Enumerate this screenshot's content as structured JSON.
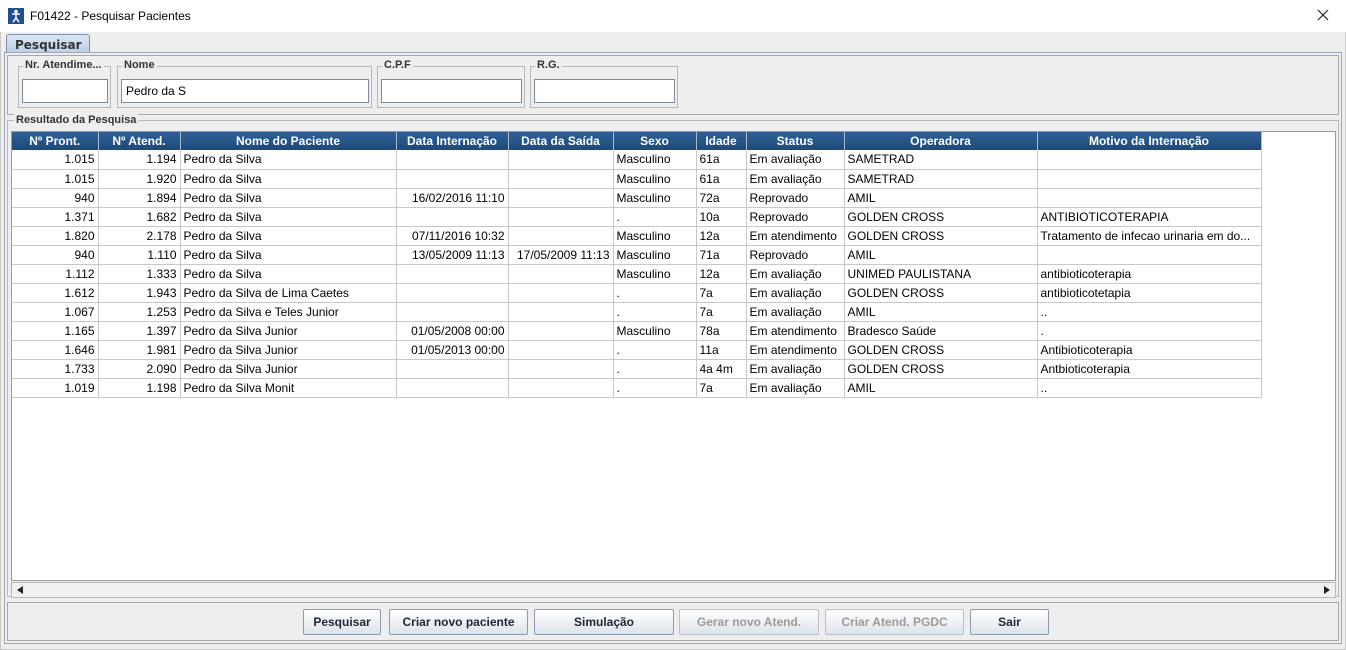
{
  "window": {
    "title": "F01422 - Pesquisar Pacientes",
    "icon": "accessibility-icon",
    "close_icon": "close-icon"
  },
  "tab": {
    "label": "Pesquisar"
  },
  "search": {
    "fields": [
      {
        "label": "Nr. Atendime...",
        "value": ""
      },
      {
        "label": "Nome",
        "value": "Pedro da S"
      },
      {
        "label": "C.P.F",
        "value": ""
      },
      {
        "label": "R.G.",
        "value": ""
      }
    ]
  },
  "results": {
    "group_label": "Resultado da Pesquisa",
    "columns": [
      "Nº Pront.",
      "Nº Atend.",
      "Nome do Paciente",
      "Data Internação",
      "Data da Saída",
      "Sexo",
      "Idade",
      "Status",
      "Operadora",
      "Motivo da Internação"
    ],
    "rows": [
      [
        "1.015",
        "1.194",
        "Pedro da Silva",
        "",
        "",
        "Masculino",
        "61a",
        "Em avaliação",
        "SAMETRAD",
        ""
      ],
      [
        "1.015",
        "1.920",
        "Pedro da Silva",
        "",
        "",
        "Masculino",
        "61a",
        "Em avaliação",
        "SAMETRAD",
        ""
      ],
      [
        "940",
        "1.894",
        "Pedro da Silva",
        "16/02/2016 11:10",
        "",
        "Masculino",
        "72a",
        "Reprovado",
        "AMIL",
        ""
      ],
      [
        "1.371",
        "1.682",
        "Pedro da Silva",
        "",
        "",
        ".",
        "10a",
        "Reprovado",
        "GOLDEN CROSS",
        "ANTIBIOTICOTERAPIA"
      ],
      [
        "1.820",
        "2.178",
        "Pedro da Silva",
        "07/11/2016 10:32",
        "",
        "Masculino",
        "12a",
        "Em atendimento",
        "GOLDEN CROSS",
        "Tratamento de infecao urinaria em do..."
      ],
      [
        "940",
        "1.110",
        "Pedro da Silva",
        "13/05/2009 11:13",
        "17/05/2009 11:13",
        "Masculino",
        "71a",
        "Reprovado",
        "AMIL",
        ""
      ],
      [
        "1.112",
        "1.333",
        "Pedro da Silva",
        "",
        "",
        "Masculino",
        "12a",
        "Em avaliação",
        "UNIMED PAULISTANA",
        "antibioticoterapia"
      ],
      [
        "1.612",
        "1.943",
        "Pedro da Silva de Lima Caetes",
        "",
        "",
        ".",
        "7a",
        "Em avaliação",
        "GOLDEN CROSS",
        "antibioticotetapia"
      ],
      [
        "1.067",
        "1.253",
        "Pedro da Silva e Teles Junior",
        "",
        "",
        ".",
        "7a",
        "Em avaliação",
        "AMIL",
        ".."
      ],
      [
        "1.165",
        "1.397",
        "Pedro da Silva Junior",
        "01/05/2008 00:00",
        "",
        "Masculino",
        "78a",
        "Em atendimento",
        "Bradesco Saúde",
        "."
      ],
      [
        "1.646",
        "1.981",
        "Pedro da Silva Junior",
        "01/05/2013 00:00",
        "",
        ".",
        "11a",
        "Em atendimento",
        "GOLDEN CROSS",
        "Antibioticoterapia"
      ],
      [
        "1.733",
        "2.090",
        "Pedro da Silva Junior",
        "",
        "",
        ".",
        "4a 4m",
        "Em avaliação",
        "GOLDEN CROSS",
        "Antbioticoterapia"
      ],
      [
        "1.019",
        "1.198",
        "Pedro da Silva Monit",
        "",
        "",
        ".",
        "7a",
        "Em avaliação",
        "AMIL",
        ".."
      ]
    ]
  },
  "scrollbar": {
    "left_icon": "arrow-left-icon",
    "right_icon": "arrow-right-icon"
  },
  "buttons": [
    {
      "label": "Pesquisar",
      "enabled": true
    },
    {
      "label": "Criar novo paciente",
      "enabled": true
    },
    {
      "label": "Simulação",
      "enabled": true
    },
    {
      "label": "Gerar novo Atend.",
      "enabled": false
    },
    {
      "label": "Criar Atend. PGDC",
      "enabled": false
    },
    {
      "label": "Sair",
      "enabled": true
    }
  ]
}
